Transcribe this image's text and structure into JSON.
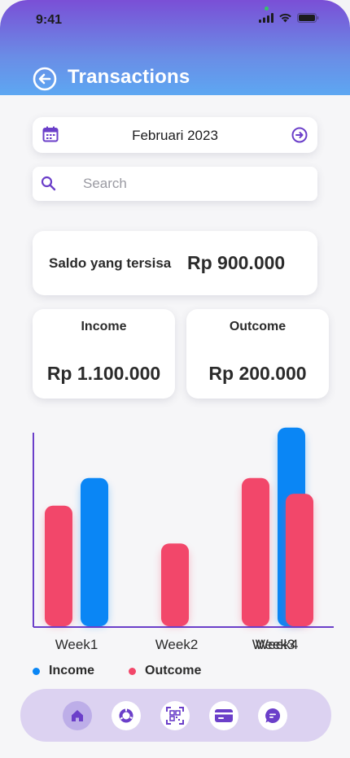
{
  "status_bar": {
    "time": "9:41"
  },
  "header": {
    "title": "Transactions"
  },
  "period": {
    "month": "Februari 2023"
  },
  "search": {
    "placeholder": "Search"
  },
  "balance": {
    "label": "Saldo yang tersisa",
    "value": "Rp 900.000"
  },
  "income": {
    "label": "Income",
    "value": "Rp 1.100.000"
  },
  "outcome": {
    "label": "Outcome",
    "value": "Rp 200.000"
  },
  "colors": {
    "income": "#0a86f5",
    "outcome": "#f2476a",
    "accent": "#6b3fc9",
    "header_top": "#7a4fd6",
    "header_bottom": "#5da7f2"
  },
  "chart_data": {
    "type": "bar",
    "categories": [
      "Week1",
      "Week2",
      "Week3",
      "Week4"
    ],
    "series": [
      {
        "name": "Income",
        "color": "#0a86f5",
        "values": [
          188,
          null,
          252,
          null
        ]
      },
      {
        "name": "Outcome",
        "color": "#f2476a",
        "values": [
          153,
          105,
          188,
          168
        ]
      }
    ],
    "ylim": [
      0,
      260
    ],
    "grid": false
  },
  "legend": [
    {
      "label": "Income",
      "color": "#0a86f5"
    },
    {
      "label": "Outcome",
      "color": "#f2476a"
    }
  ],
  "nav": {
    "items": [
      {
        "icon": "home-icon",
        "active": true
      },
      {
        "icon": "chart-icon",
        "active": false
      },
      {
        "icon": "qr-scan-icon",
        "active": false
      },
      {
        "icon": "card-icon",
        "active": false
      },
      {
        "icon": "chat-icon",
        "active": false
      }
    ]
  }
}
